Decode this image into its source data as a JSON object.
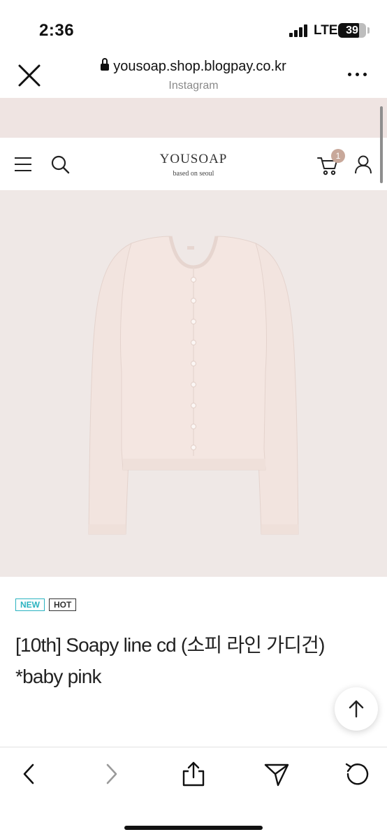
{
  "status_bar": {
    "time": "2:36",
    "network": "LTE",
    "battery": "39"
  },
  "browser": {
    "url": "yousoap.shop.blogpay.co.kr",
    "subtitle": "Instagram",
    "load_progress": 0.84,
    "icons": {
      "close": "close-icon",
      "lock": "lock-icon",
      "more": "more-icon"
    }
  },
  "site": {
    "logo": "YOUSOAP",
    "tagline": "based on seoul",
    "cart_count": "1",
    "icons": {
      "menu": "hamburger-menu-icon",
      "search": "search-icon",
      "cart": "cart-icon",
      "account": "user-icon"
    }
  },
  "product": {
    "badges": [
      "NEW",
      "HOT"
    ],
    "title": "[10th] Soapy line cd (소피 라인 가디건) *baby pink",
    "image": "light-pink ribbed button-up cardigan"
  },
  "toolbar": {
    "icons": [
      "back-icon",
      "forward-icon",
      "share-icon",
      "send-icon",
      "reload-icon"
    ]
  },
  "colors": {
    "accent": "#4a9fe4",
    "promo_strip": "#efe4e2",
    "image_bg": "#efe8e6",
    "cardigan": "#f1e2dd",
    "badge_new": "#2bb3c0",
    "cart_badge": "#c8a89a"
  }
}
